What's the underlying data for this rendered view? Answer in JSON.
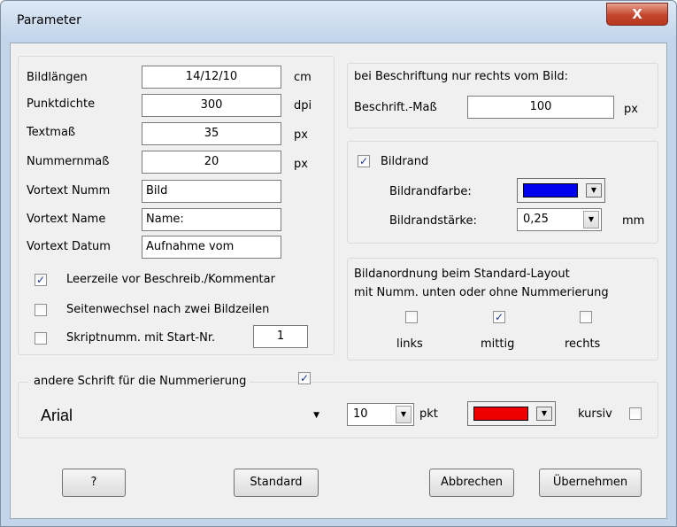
{
  "window": {
    "title": "Parameter",
    "close_glyph": "X"
  },
  "dimensions": {
    "rows": [
      {
        "label": "Bildlängen",
        "value": "14/12/10",
        "unit": "cm"
      },
      {
        "label": "Punktdichte",
        "value": "300",
        "unit": "dpi"
      },
      {
        "label": "Textmaß",
        "value": "35",
        "unit": "px"
      },
      {
        "label": "Nummernmaß",
        "value": "20",
        "unit": "px"
      }
    ]
  },
  "pretext": {
    "rows": [
      {
        "label": "Vortext Numm",
        "value": "Bild"
      },
      {
        "label": "Vortext Name",
        "value": "Name:"
      },
      {
        "label": "Vortext Datum",
        "value": "Aufnahme vom"
      }
    ]
  },
  "options": {
    "leerzeile": {
      "label": "Leerzeile vor Beschreib./Kommentar",
      "checked": true
    },
    "seitenwechsel": {
      "label": "Seitenwechsel nach zwei Bildzeilen",
      "checked": false
    },
    "skriptnumm": {
      "label": "Skriptnumm. mit Start-Nr.",
      "checked": false,
      "value": "1"
    }
  },
  "beschriftung": {
    "heading": "bei Beschriftung nur rechts vom Bild:",
    "label": "Beschrift.-Maß",
    "value": "100",
    "unit": "px"
  },
  "bildrand": {
    "label": "Bildrand",
    "checked": true,
    "color_label": "Bildrandfarbe:",
    "color": "#0000ee",
    "width_label": "Bildrandstärke:",
    "width_value": "0,25",
    "width_unit": "mm"
  },
  "anordnung": {
    "heading_line1": "Bildanordnung beim Standard-Layout",
    "heading_line2": "mit Numm. unten oder ohne Nummerierung",
    "options": [
      {
        "label": "links",
        "checked": false
      },
      {
        "label": "mittig",
        "checked": true
      },
      {
        "label": "rechts",
        "checked": false
      }
    ]
  },
  "font": {
    "heading": "andere Schrift für die Nummerierung",
    "enabled": true,
    "name": "Arial",
    "size": "10",
    "size_unit": "pkt",
    "color": "#ee0000",
    "italic_label": "kursiv",
    "italic": false
  },
  "buttons": {
    "help": "?",
    "standard": "Standard",
    "cancel": "Abbrechen",
    "apply": "Übernehmen"
  },
  "glyphs": {
    "check": "✓",
    "down": "▼"
  }
}
